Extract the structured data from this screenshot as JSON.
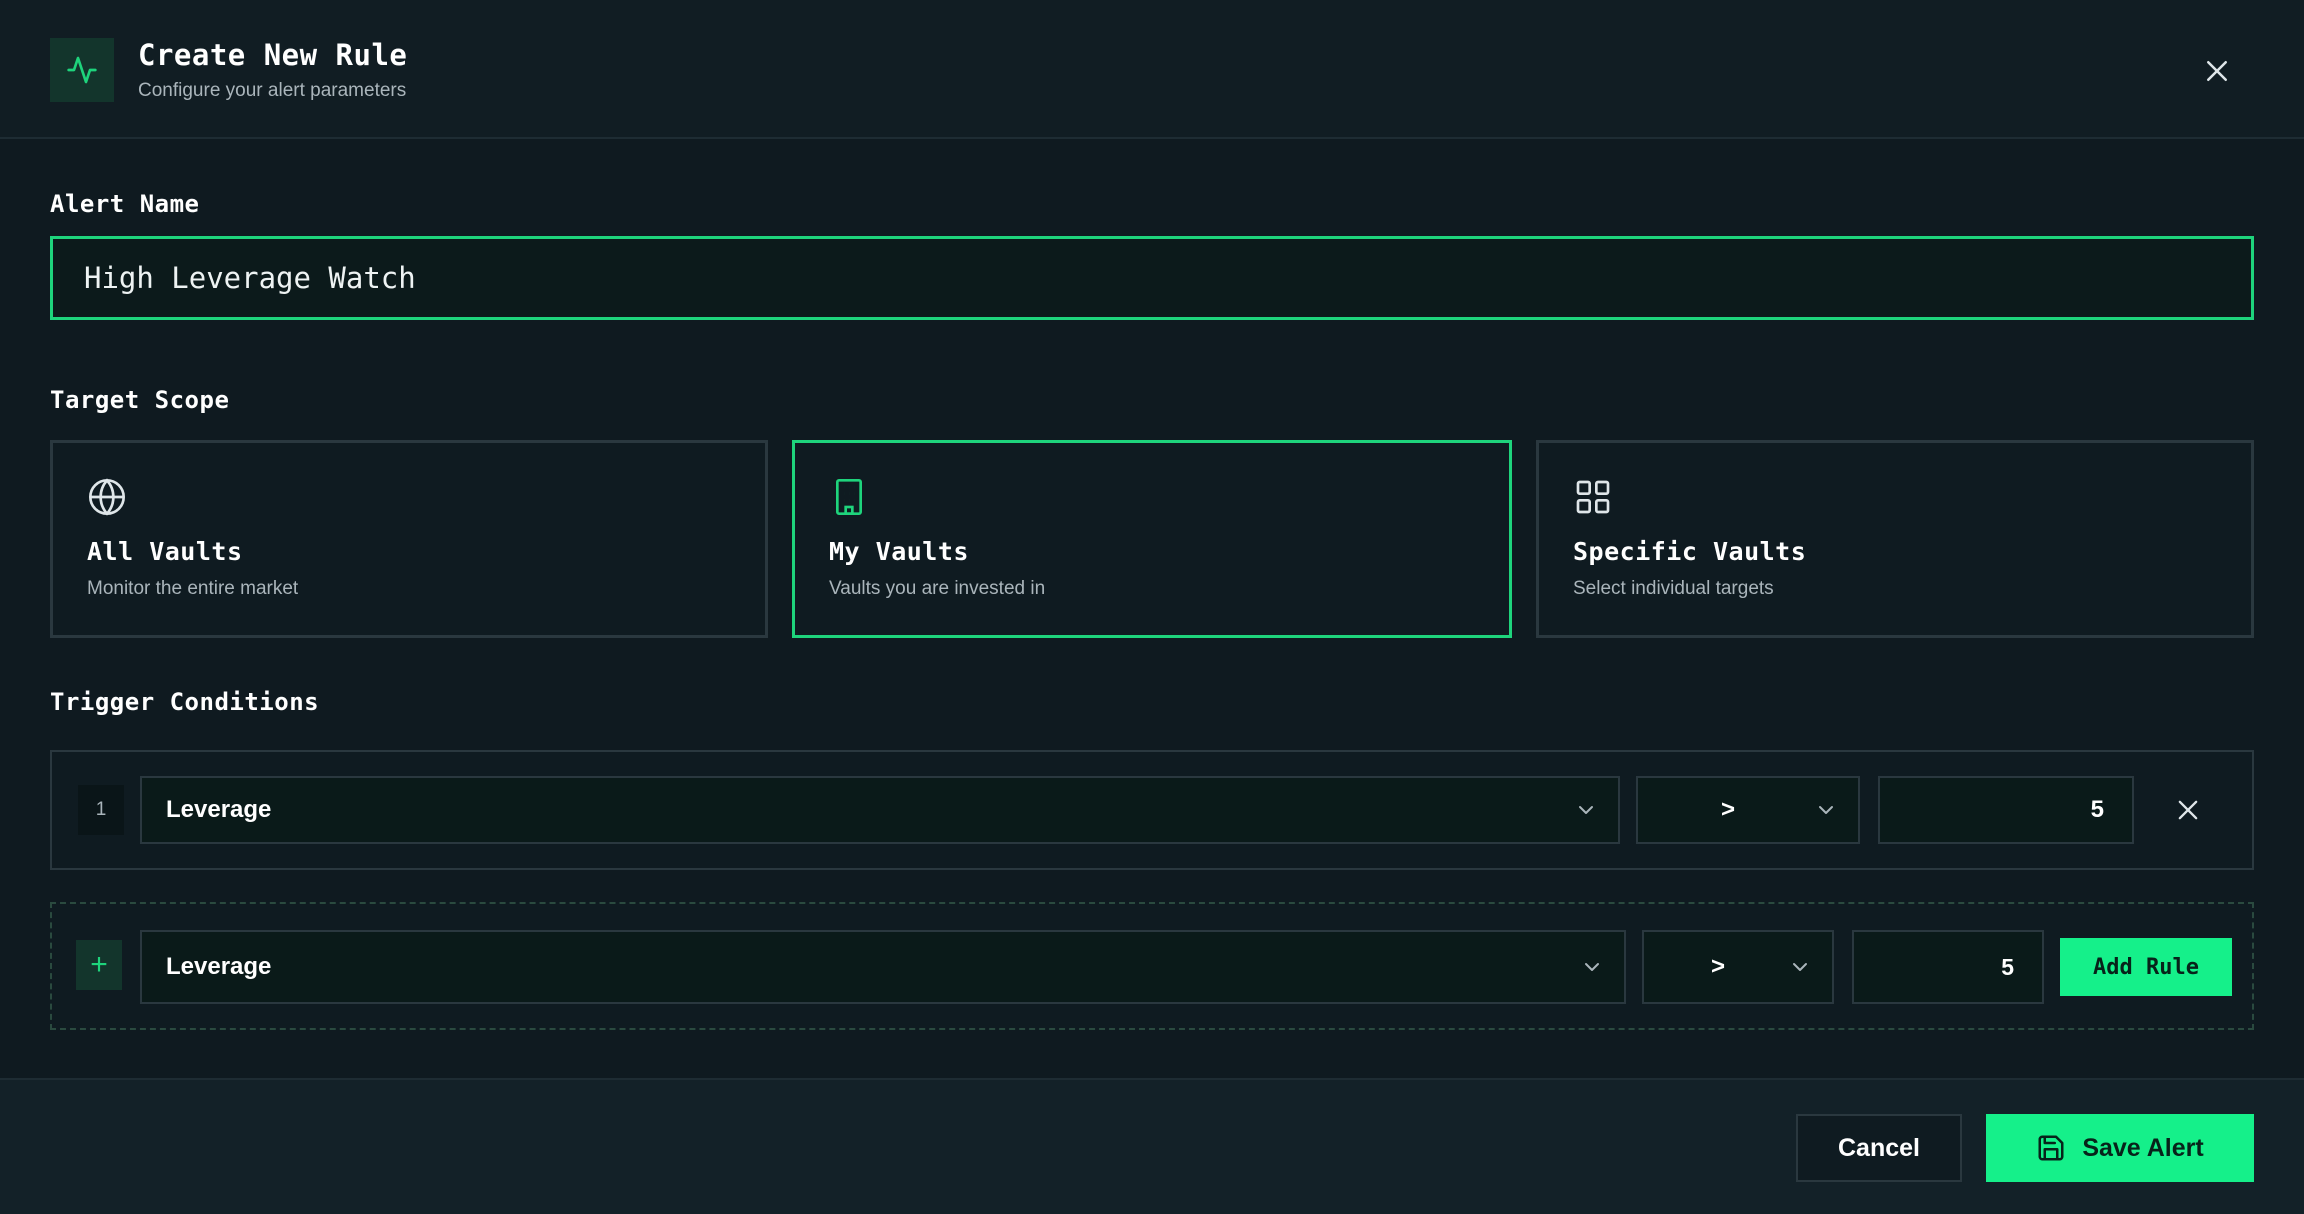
{
  "header": {
    "title": "Create New Rule",
    "subtitle": "Configure your alert parameters",
    "icon": "activity-icon"
  },
  "alert_name": {
    "label": "Alert Name",
    "value": "High Leverage Watch"
  },
  "target_scope": {
    "label": "Target Scope",
    "selected": "my-vaults",
    "options": [
      {
        "title": "All Vaults",
        "description": "Monitor the entire market",
        "icon": "globe-icon"
      },
      {
        "title": "My Vaults",
        "description": "Vaults you are invested in",
        "icon": "building-icon"
      },
      {
        "title": "Specific Vaults",
        "description": "Select individual targets",
        "icon": "grid-icon"
      }
    ]
  },
  "trigger_conditions": {
    "label": "Trigger Conditions",
    "rules": [
      {
        "index": "1",
        "metric": "Leverage",
        "operator": ">",
        "value": "5"
      }
    ],
    "new_rule": {
      "badge": "+",
      "metric": "Leverage",
      "operator": ">",
      "value": "5",
      "add_label": "Add Rule"
    }
  },
  "footer": {
    "cancel_label": "Cancel",
    "save_label": "Save Alert"
  },
  "colors": {
    "accent": "#15f08a",
    "background": "#0f1a20",
    "border": "#2a383f"
  }
}
